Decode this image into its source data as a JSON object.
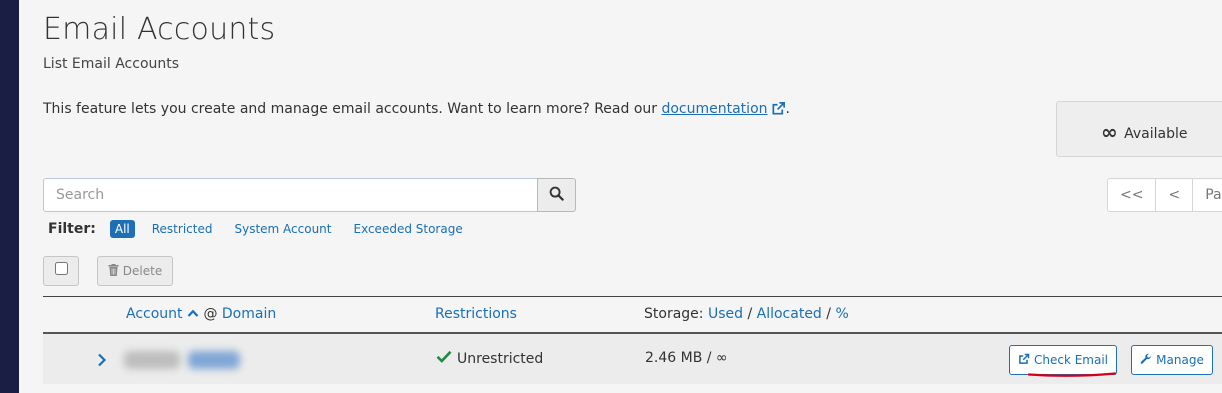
{
  "page": {
    "title": "Email Accounts",
    "subtitle": "List Email Accounts",
    "intro_text": "This feature lets you create and manage email accounts. Want to learn more? Read our ",
    "doc_link": "documentation",
    "intro_end": "."
  },
  "available": {
    "symbol": "∞",
    "label": "Available"
  },
  "search": {
    "placeholder": "Search",
    "value": ""
  },
  "pagination": {
    "first": "<<",
    "prev": "<",
    "page_label": "Page"
  },
  "filter": {
    "label": "Filter:",
    "options": [
      "All",
      "Restricted",
      "System Account",
      "Exceeded Storage"
    ],
    "selected": "All"
  },
  "toolbar": {
    "delete_label": "Delete"
  },
  "table": {
    "columns": {
      "account": "Account",
      "at": "@",
      "domain": "Domain",
      "restrictions": "Restrictions",
      "storage_prefix": "Storage:",
      "used": "Used",
      "sep1": "/",
      "allocated": "Allocated",
      "sep2": "/",
      "percent": "%"
    },
    "rows": [
      {
        "restriction": "Unrestricted",
        "storage": "2.46 MB / ∞",
        "check_email": "Check Email",
        "manage": "Manage"
      }
    ]
  },
  "colors": {
    "accent": "#1f6fb5",
    "link": "#1a6fb5",
    "sidebar": "#1b1e44",
    "success": "#1e8c45",
    "annotation": "#d0021b"
  },
  "icons": {
    "external": "external-link-icon",
    "search": "search-icon",
    "trash": "trash-icon",
    "sort": "caret-up-icon",
    "chevron": "chevron-right-icon",
    "check": "check-icon",
    "wrench": "wrench-icon"
  }
}
